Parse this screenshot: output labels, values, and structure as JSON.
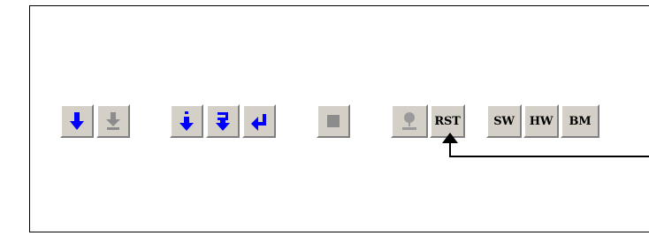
{
  "toolbar": {
    "buttons": [
      {
        "name": "download-button",
        "icon": "arrow-down-icon",
        "enabled": true
      },
      {
        "name": "download-all-button",
        "icon": "arrow-down-bar-icon",
        "enabled": false
      },
      {
        "name": "step-into-button",
        "icon": "step-into-icon",
        "enabled": true
      },
      {
        "name": "step-over-button",
        "icon": "step-over-icon",
        "enabled": true
      },
      {
        "name": "step-out-button",
        "icon": "step-out-icon",
        "enabled": true
      },
      {
        "name": "stop-button",
        "icon": "stop-icon",
        "enabled": false
      },
      {
        "name": "breakpoint-button",
        "icon": "breakpoint-pin-icon",
        "enabled": false
      },
      {
        "name": "rst-button",
        "label": "RST",
        "enabled": true
      },
      {
        "name": "sw-button",
        "label": "SW",
        "enabled": true
      },
      {
        "name": "hw-button",
        "label": "HW",
        "enabled": true
      },
      {
        "name": "bm-button",
        "label": "BM",
        "enabled": true
      }
    ]
  },
  "colors": {
    "active_icon": "#0000ff",
    "disabled_icon": "#8c8c8c",
    "button_face": "#d4d0c8",
    "callout_line": "#000000"
  }
}
